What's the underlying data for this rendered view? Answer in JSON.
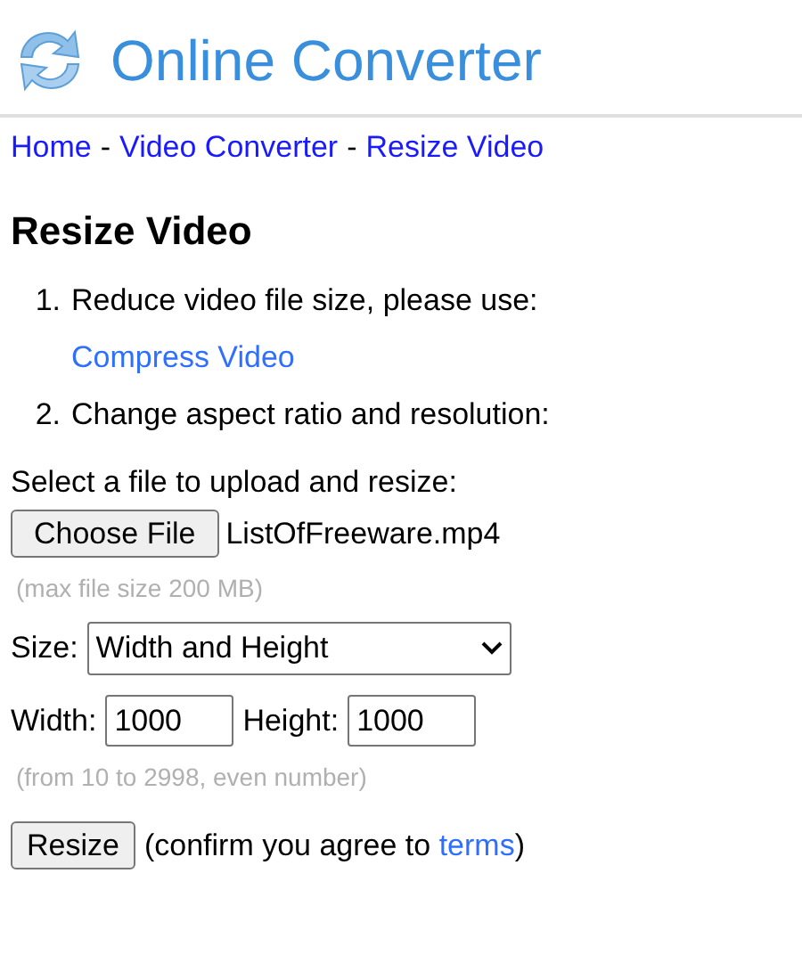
{
  "header": {
    "title": "Online Converter"
  },
  "breadcrumb": [
    {
      "kind": "link",
      "text": "Home"
    },
    {
      "kind": "separator",
      "text": "-"
    },
    {
      "kind": "link",
      "text": "Video Converter"
    },
    {
      "kind": "separator",
      "text": "-"
    },
    {
      "kind": "link",
      "text": "Resize Video"
    }
  ],
  "heading": "Resize Video",
  "steps": [
    {
      "number": "1.",
      "text": "Reduce video file size, please use:",
      "link": "Compress Video"
    },
    {
      "number": "2.",
      "text": "Change aspect ratio and resolution:"
    }
  ],
  "form": {
    "file_label": "Select a file to upload and resize:",
    "file_button": "Choose File",
    "file_name": "ListOfFreeware.mp4",
    "file_hint": "(max file size 200 MB)",
    "size_label": "Size:",
    "size_value": "Width and Height",
    "width_label": "Width:",
    "width_value": "1000",
    "height_label": "Height:",
    "height_value": "1000",
    "dimension_hint": "(from 10 to 2998, even number)",
    "submit_button": "Resize",
    "confirm_before": "(confirm you agree to ",
    "confirm_link": "terms",
    "confirm_after": ")"
  }
}
